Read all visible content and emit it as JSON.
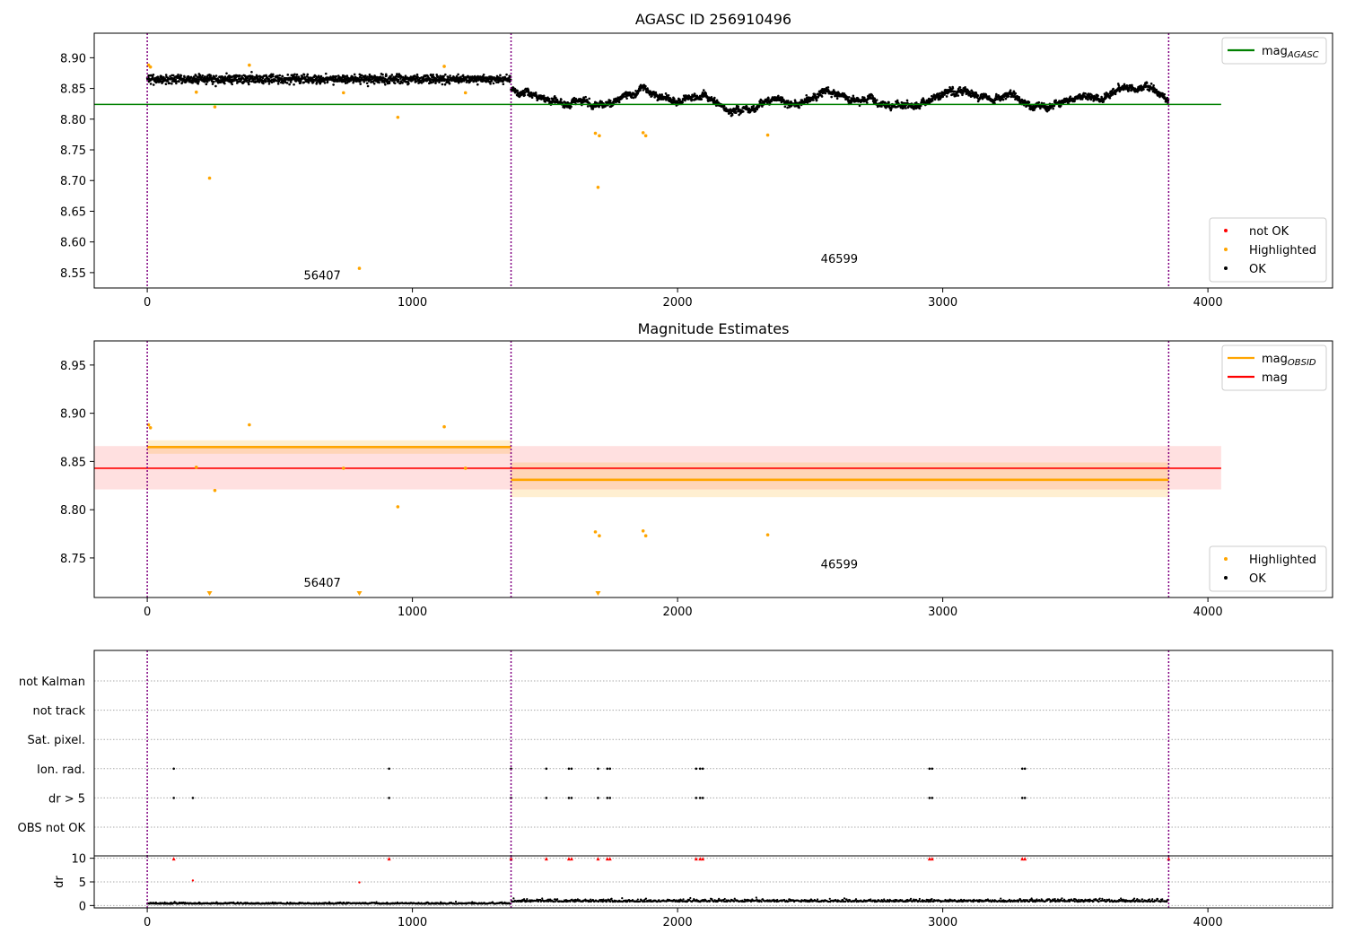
{
  "chart_data": [
    {
      "type": "scatter",
      "title": "AGASC ID 256910496",
      "xlim": [
        -200,
        4470
      ],
      "ylim": [
        8.525,
        8.94
      ],
      "xticks": [
        0,
        1000,
        2000,
        3000,
        4000
      ],
      "yticks": [
        8.55,
        8.6,
        8.65,
        8.7,
        8.75,
        8.8,
        8.85,
        8.9
      ],
      "grid": false,
      "obsid_boundaries": [
        0,
        1372,
        3852
      ],
      "obsid_labels": [
        {
          "text": "56407",
          "x": 590,
          "y": 8.539
        },
        {
          "text": "46599",
          "x": 2540,
          "y": 8.566
        }
      ],
      "hlines": [
        {
          "name": "mag_AGASC",
          "y": 8.824,
          "x0": -200,
          "x1": 4050,
          "color": "#008000"
        }
      ],
      "series": [
        {
          "name": "not OK",
          "color": "#ff0000"
        },
        {
          "name": "Highlighted",
          "color": "#ffa500"
        },
        {
          "name": "OK",
          "color": "#000000"
        }
      ],
      "segments": [
        {
          "x0": 0,
          "x1": 1372,
          "level": 8.865,
          "noise": 0.006
        },
        {
          "x0": 1372,
          "x1": 3852,
          "level": 8.832,
          "noise": 0.012
        }
      ],
      "highlighted_points": [
        [
          5,
          8.888
        ],
        [
          12,
          8.885
        ],
        [
          185,
          8.844
        ],
        [
          235,
          8.704
        ],
        [
          255,
          8.82
        ],
        [
          385,
          8.888
        ],
        [
          740,
          8.843
        ],
        [
          800,
          8.557
        ],
        [
          945,
          8.803
        ],
        [
          1120,
          8.886
        ],
        [
          1200,
          8.843
        ],
        [
          1690,
          8.777
        ],
        [
          1700,
          8.689
        ],
        [
          1705,
          8.773
        ],
        [
          1870,
          8.778
        ],
        [
          1880,
          8.773
        ],
        [
          2340,
          8.774
        ]
      ],
      "legends": [
        {
          "position": "top-right",
          "entries": [
            {
              "label": "mag",
              "sub": "AGASC",
              "color": "#008000",
              "kind": "line"
            }
          ]
        },
        {
          "position": "lower-right",
          "entries": [
            {
              "label": "not OK",
              "color": "#ff0000",
              "kind": "dot"
            },
            {
              "label": "Highlighted",
              "color": "#ffa500",
              "kind": "dot"
            },
            {
              "label": "OK",
              "color": "#000000",
              "kind": "dot"
            }
          ]
        }
      ]
    },
    {
      "type": "scatter",
      "title": "Magnitude Estimates",
      "xlim": [
        -200,
        4470
      ],
      "ylim": [
        8.709,
        8.975
      ],
      "xticks": [
        0,
        1000,
        2000,
        3000,
        4000
      ],
      "yticks": [
        8.75,
        8.8,
        8.85,
        8.9,
        8.95
      ],
      "grid": false,
      "obsid_boundaries": [
        0,
        1372,
        3852
      ],
      "obsid_labels": [
        {
          "text": "56407",
          "x": 590,
          "y": 8.72
        },
        {
          "text": "46599",
          "x": 2540,
          "y": 8.739
        }
      ],
      "mag_obsid": [
        {
          "x0": 0,
          "x1": 1372,
          "y": 8.865,
          "band": [
            8.858,
            8.872
          ]
        },
        {
          "x0": 1372,
          "x1": 3852,
          "y": 8.831,
          "band": [
            8.813,
            8.849
          ]
        }
      ],
      "mag": {
        "y": 8.843,
        "x0": -200,
        "x1": 4050,
        "band": [
          8.821,
          8.866
        ]
      },
      "highlighted_points": [
        [
          5,
          8.888
        ],
        [
          12,
          8.885
        ],
        [
          185,
          8.844
        ],
        [
          255,
          8.82
        ],
        [
          385,
          8.888
        ],
        [
          740,
          8.843
        ],
        [
          945,
          8.803
        ],
        [
          1120,
          8.886
        ],
        [
          1200,
          8.843
        ],
        [
          1690,
          8.777
        ],
        [
          1705,
          8.773
        ],
        [
          1870,
          8.778
        ],
        [
          1880,
          8.773
        ],
        [
          2340,
          8.774
        ]
      ],
      "out_of_range_markers": [
        235,
        800,
        1700
      ],
      "legends": [
        {
          "position": "top-right",
          "entries": [
            {
              "label": "mag",
              "sub": "OBSID",
              "color": "#ffa500",
              "kind": "line"
            },
            {
              "label": "mag",
              "sub": "",
              "color": "#ff0000",
              "kind": "line"
            }
          ]
        },
        {
          "position": "lower-right",
          "entries": [
            {
              "label": "Highlighted",
              "color": "#ffa500",
              "kind": "dot"
            },
            {
              "label": "OK",
              "color": "#000000",
              "kind": "dot"
            }
          ]
        }
      ]
    },
    {
      "type": "scatter",
      "title": "",
      "xlim": [
        -200,
        4470
      ],
      "xticks": [
        0,
        1000,
        2000,
        3000,
        4000
      ],
      "flag_rows": [
        "not Kalman",
        "not track",
        "Sat. pixel.",
        "Ion. rad.",
        "dr > 5",
        "OBS not OK"
      ],
      "flag_events": {
        "Ion. rad.": [
          100,
          912,
          1372,
          1505,
          1590,
          1600,
          1700,
          1735,
          1745,
          2070,
          2085,
          2095,
          2950,
          2960,
          3300,
          3310
        ],
        "dr > 5": [
          100,
          172,
          912,
          1372,
          1505,
          1590,
          1600,
          1700,
          1735,
          1745,
          2070,
          2085,
          2095,
          2950,
          2960,
          3300,
          3310
        ]
      },
      "dr_ylabel": "dr",
      "dr_yticks": [
        0,
        5,
        10
      ],
      "dr_ylim": [
        -0.5,
        10.5
      ],
      "dr_high_markers": [
        100,
        912,
        1372,
        1505,
        1590,
        1600,
        1700,
        1735,
        1745,
        2070,
        2085,
        2095,
        2950,
        2960,
        3300,
        3310,
        3852
      ],
      "dr_other_points": [
        [
          172,
          5.3
        ],
        [
          800,
          4.9
        ]
      ],
      "obsid_boundaries": [
        0,
        1372,
        3852
      ]
    }
  ]
}
